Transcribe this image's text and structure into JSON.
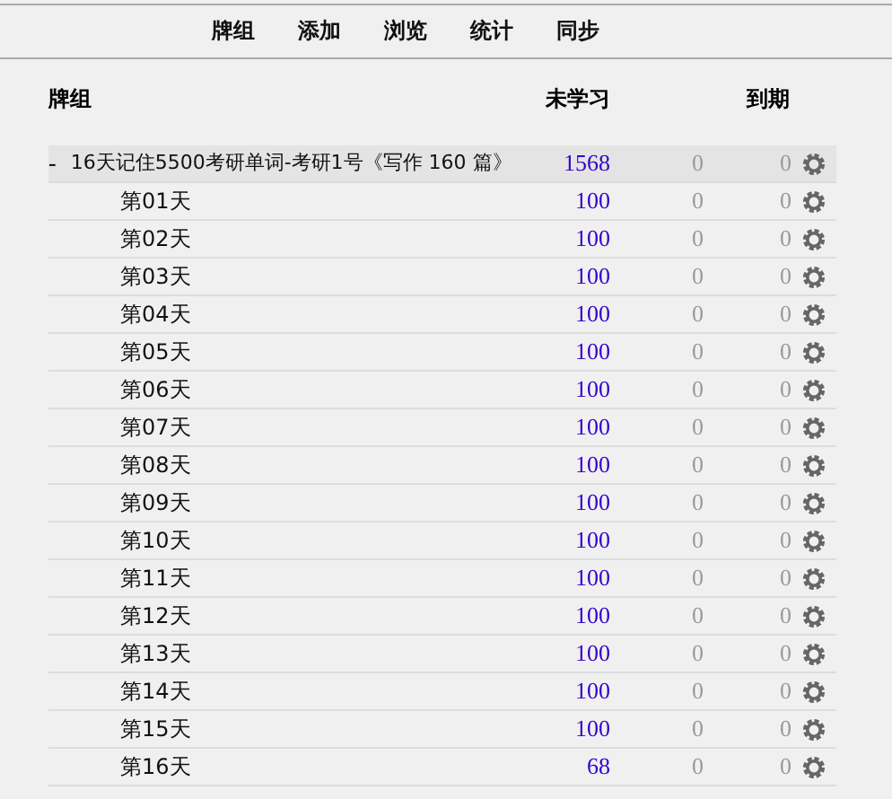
{
  "nav": [
    {
      "label": "牌组"
    },
    {
      "label": "添加"
    },
    {
      "label": "浏览"
    },
    {
      "label": "统计"
    },
    {
      "label": "同步"
    }
  ],
  "table": {
    "columns": [
      {
        "label": "牌组"
      },
      {
        "label": "未学习"
      },
      {
        "label": "到期"
      }
    ],
    "decks": [
      {
        "toggle": "-",
        "name": "16天记住5500考研单词-考研1号《写作 160 篇》",
        "new": "1568",
        "due_1": "0",
        "due_2": "0",
        "selected": true,
        "children": [
          {
            "name": "第01天",
            "new": "100",
            "due_1": "0",
            "due_2": "0",
            "selected": false
          },
          {
            "name": "第02天",
            "new": "100",
            "due_1": "0",
            "due_2": "0",
            "selected": false
          },
          {
            "name": "第03天",
            "new": "100",
            "due_1": "0",
            "due_2": "0",
            "selected": false
          },
          {
            "name": "第04天",
            "new": "100",
            "due_1": "0",
            "due_2": "0",
            "selected": false
          },
          {
            "name": "第05天",
            "new": "100",
            "due_1": "0",
            "due_2": "0",
            "selected": false
          },
          {
            "name": "第06天",
            "new": "100",
            "due_1": "0",
            "due_2": "0",
            "selected": false
          },
          {
            "name": "第07天",
            "new": "100",
            "due_1": "0",
            "due_2": "0",
            "selected": false
          },
          {
            "name": "第08天",
            "new": "100",
            "due_1": "0",
            "due_2": "0",
            "selected": false
          },
          {
            "name": "第09天",
            "new": "100",
            "due_1": "0",
            "due_2": "0",
            "selected": false
          },
          {
            "name": "第10天",
            "new": "100",
            "due_1": "0",
            "due_2": "0",
            "selected": false
          },
          {
            "name": "第11天",
            "new": "100",
            "due_1": "0",
            "due_2": "0",
            "selected": false
          },
          {
            "name": "第12天",
            "new": "100",
            "due_1": "0",
            "due_2": "0",
            "selected": false
          },
          {
            "name": "第13天",
            "new": "100",
            "due_1": "0",
            "due_2": "0",
            "selected": false
          },
          {
            "name": "第14天",
            "new": "100",
            "due_1": "0",
            "due_2": "0",
            "selected": false
          },
          {
            "name": "第15天",
            "new": "100",
            "due_1": "0",
            "due_2": "0",
            "selected": false
          },
          {
            "name": "第16天",
            "new": "68",
            "due_1": "0",
            "due_2": "0",
            "selected": false
          }
        ]
      }
    ]
  }
}
